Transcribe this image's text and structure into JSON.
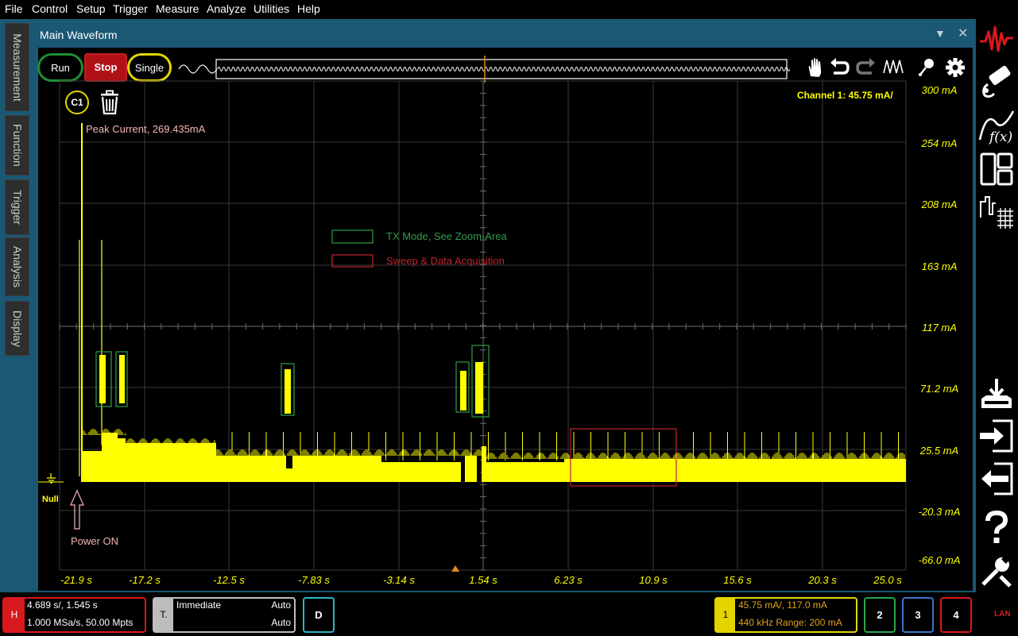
{
  "menu": [
    "File",
    "Control",
    "Setup",
    "Trigger",
    "Measure",
    "Analyze",
    "Utilities",
    "Help"
  ],
  "left_tabs": [
    "Measurement",
    "Function",
    "Trigger",
    "Analysis",
    "Display"
  ],
  "window": {
    "tab_title": "Main Waveform",
    "dropdown_glyph": "▼",
    "close_glyph": "✕"
  },
  "run_controls": {
    "run": "Run",
    "stop": "Stop",
    "single": "Single"
  },
  "channel_marker": "C1",
  "channel_scale": "Channel 1:  45.75 mA/",
  "y_axis_labels": [
    "300 mA",
    "254 mA",
    "208 mA",
    "163 mA",
    "117 mA",
    "71.2 mA",
    "25.5 mA",
    "-20.3 mA",
    "-66.0 mA"
  ],
  "x_axis_labels": [
    "-21.9 s",
    "-17.2 s",
    "-12.5 s",
    "-7.83 s",
    "-3.14 s",
    "1.54 s",
    "6.23 s",
    "10.9 s",
    "15.6 s",
    "20.3 s",
    "25.0 s"
  ],
  "annotations": {
    "peak": "Peak Current, 269.435mA",
    "legend_green": "TX Mode, See Zoom-Area",
    "legend_red": "Sweep & Data Acquisition",
    "power_on": "Power ON",
    "null_label": "Null"
  },
  "colors": {
    "trace": "#ffff00",
    "tx_box": "#2e9e4a",
    "sweep_box": "#c0232b",
    "accent": "#1b5874"
  },
  "horizontal": {
    "badge": "H",
    "line1": "4.689 s/, 1.545 s",
    "line2": "1.000 MSa/s, 50.00 Mpts"
  },
  "trigger": {
    "badge": "T.",
    "mode": "Immediate",
    "sweep": "Auto",
    "coupling": "Auto"
  },
  "digital": {
    "label": "D"
  },
  "channel1": {
    "badge": "1",
    "line1": "45.75 mA/, 117.0 mA",
    "line2": "440 kHz   Range: 200 mA"
  },
  "channels": [
    "2",
    "3",
    "4"
  ],
  "lan": "LAN",
  "icons": {
    "toolbar": [
      "waveform-icon",
      "pan-hand-icon",
      "undo-icon",
      "redo-icon",
      "autoscale-icon",
      "marker-probe-icon",
      "settings-gear-icon"
    ],
    "right": [
      "keysight-logo-icon",
      "probe-icon",
      "math-function-icon",
      "layout-icon",
      "export-waveform-icon",
      "save-icon",
      "import-icon",
      "export-icon",
      "help-icon",
      "tools-icon"
    ],
    "trash": "trash-icon"
  }
}
